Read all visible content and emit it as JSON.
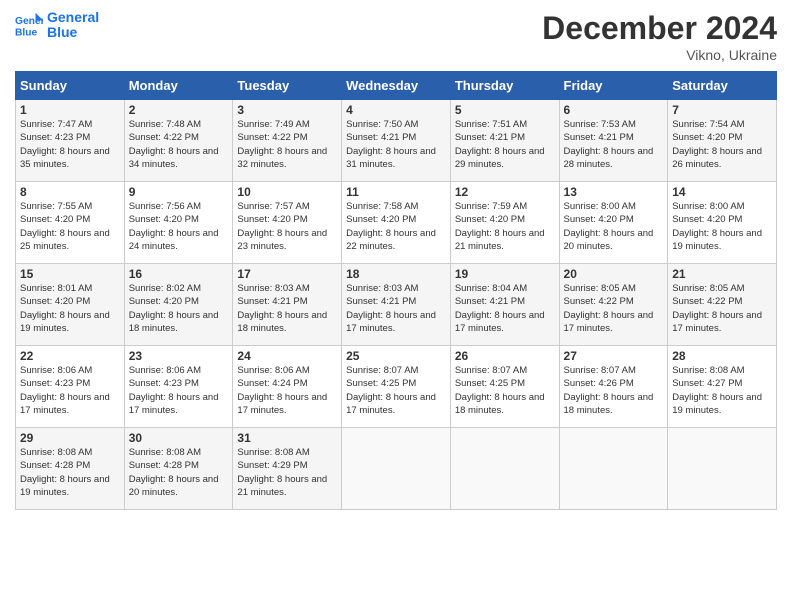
{
  "header": {
    "logo_line1": "General",
    "logo_line2": "Blue",
    "title": "December 2024",
    "subtitle": "Vikno, Ukraine"
  },
  "weekdays": [
    "Sunday",
    "Monday",
    "Tuesday",
    "Wednesday",
    "Thursday",
    "Friday",
    "Saturday"
  ],
  "weeks": [
    [
      {
        "day": "1",
        "sunrise": "7:47 AM",
        "sunset": "4:23 PM",
        "daylight": "8 hours and 35 minutes."
      },
      {
        "day": "2",
        "sunrise": "7:48 AM",
        "sunset": "4:22 PM",
        "daylight": "8 hours and 34 minutes."
      },
      {
        "day": "3",
        "sunrise": "7:49 AM",
        "sunset": "4:22 PM",
        "daylight": "8 hours and 32 minutes."
      },
      {
        "day": "4",
        "sunrise": "7:50 AM",
        "sunset": "4:21 PM",
        "daylight": "8 hours and 31 minutes."
      },
      {
        "day": "5",
        "sunrise": "7:51 AM",
        "sunset": "4:21 PM",
        "daylight": "8 hours and 29 minutes."
      },
      {
        "day": "6",
        "sunrise": "7:53 AM",
        "sunset": "4:21 PM",
        "daylight": "8 hours and 28 minutes."
      },
      {
        "day": "7",
        "sunrise": "7:54 AM",
        "sunset": "4:20 PM",
        "daylight": "8 hours and 26 minutes."
      }
    ],
    [
      {
        "day": "8",
        "sunrise": "7:55 AM",
        "sunset": "4:20 PM",
        "daylight": "8 hours and 25 minutes."
      },
      {
        "day": "9",
        "sunrise": "7:56 AM",
        "sunset": "4:20 PM",
        "daylight": "8 hours and 24 minutes."
      },
      {
        "day": "10",
        "sunrise": "7:57 AM",
        "sunset": "4:20 PM",
        "daylight": "8 hours and 23 minutes."
      },
      {
        "day": "11",
        "sunrise": "7:58 AM",
        "sunset": "4:20 PM",
        "daylight": "8 hours and 22 minutes."
      },
      {
        "day": "12",
        "sunrise": "7:59 AM",
        "sunset": "4:20 PM",
        "daylight": "8 hours and 21 minutes."
      },
      {
        "day": "13",
        "sunrise": "8:00 AM",
        "sunset": "4:20 PM",
        "daylight": "8 hours and 20 minutes."
      },
      {
        "day": "14",
        "sunrise": "8:00 AM",
        "sunset": "4:20 PM",
        "daylight": "8 hours and 19 minutes."
      }
    ],
    [
      {
        "day": "15",
        "sunrise": "8:01 AM",
        "sunset": "4:20 PM",
        "daylight": "8 hours and 19 minutes."
      },
      {
        "day": "16",
        "sunrise": "8:02 AM",
        "sunset": "4:20 PM",
        "daylight": "8 hours and 18 minutes."
      },
      {
        "day": "17",
        "sunrise": "8:03 AM",
        "sunset": "4:21 PM",
        "daylight": "8 hours and 18 minutes."
      },
      {
        "day": "18",
        "sunrise": "8:03 AM",
        "sunset": "4:21 PM",
        "daylight": "8 hours and 17 minutes."
      },
      {
        "day": "19",
        "sunrise": "8:04 AM",
        "sunset": "4:21 PM",
        "daylight": "8 hours and 17 minutes."
      },
      {
        "day": "20",
        "sunrise": "8:05 AM",
        "sunset": "4:22 PM",
        "daylight": "8 hours and 17 minutes."
      },
      {
        "day": "21",
        "sunrise": "8:05 AM",
        "sunset": "4:22 PM",
        "daylight": "8 hours and 17 minutes."
      }
    ],
    [
      {
        "day": "22",
        "sunrise": "8:06 AM",
        "sunset": "4:23 PM",
        "daylight": "8 hours and 17 minutes."
      },
      {
        "day": "23",
        "sunrise": "8:06 AM",
        "sunset": "4:23 PM",
        "daylight": "8 hours and 17 minutes."
      },
      {
        "day": "24",
        "sunrise": "8:06 AM",
        "sunset": "4:24 PM",
        "daylight": "8 hours and 17 minutes."
      },
      {
        "day": "25",
        "sunrise": "8:07 AM",
        "sunset": "4:25 PM",
        "daylight": "8 hours and 17 minutes."
      },
      {
        "day": "26",
        "sunrise": "8:07 AM",
        "sunset": "4:25 PM",
        "daylight": "8 hours and 18 minutes."
      },
      {
        "day": "27",
        "sunrise": "8:07 AM",
        "sunset": "4:26 PM",
        "daylight": "8 hours and 18 minutes."
      },
      {
        "day": "28",
        "sunrise": "8:08 AM",
        "sunset": "4:27 PM",
        "daylight": "8 hours and 19 minutes."
      }
    ],
    [
      {
        "day": "29",
        "sunrise": "8:08 AM",
        "sunset": "4:28 PM",
        "daylight": "8 hours and 19 minutes."
      },
      {
        "day": "30",
        "sunrise": "8:08 AM",
        "sunset": "4:28 PM",
        "daylight": "8 hours and 20 minutes."
      },
      {
        "day": "31",
        "sunrise": "8:08 AM",
        "sunset": "4:29 PM",
        "daylight": "8 hours and 21 minutes."
      },
      null,
      null,
      null,
      null
    ]
  ],
  "labels": {
    "sunrise": "Sunrise:",
    "sunset": "Sunset:",
    "daylight": "Daylight:"
  }
}
